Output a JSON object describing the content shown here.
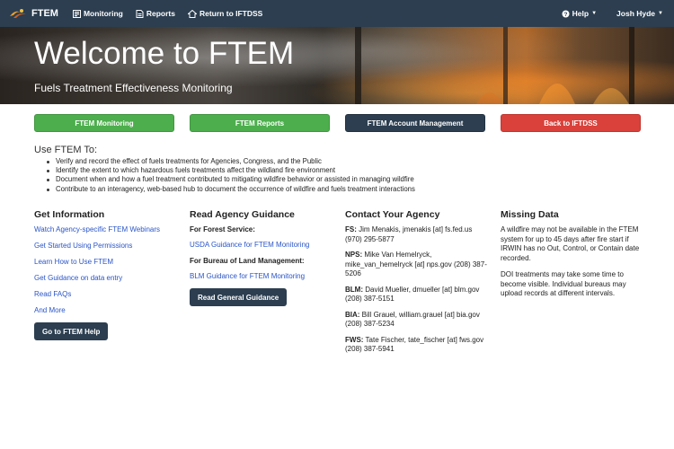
{
  "navbar": {
    "brand": "FTEM",
    "monitoring": "Monitoring",
    "reports": "Reports",
    "return": "Return to IFTDSS",
    "help": "Help",
    "user": "Josh Hyde"
  },
  "hero": {
    "title": "Welcome to FTEM",
    "subtitle": "Fuels Treatment Effectiveness Monitoring"
  },
  "buttons": {
    "monitoring": "FTEM Monitoring",
    "reports": "FTEM Reports",
    "account": "FTEM Account Management",
    "back": "Back to IFTDSS"
  },
  "use": {
    "title": "Use FTEM To:",
    "items": [
      "Verify and record the effect of fuels treatments for Agencies, Congress, and the Public",
      "Identify the extent to which hazardous fuels treatments affect the wildland fire environment",
      "Document when and how a fuel treatment contributed to mitigating wildfire behavior or assisted in managing wildfire",
      "Contribute to an interagency, web-based hub to document the occurrence of wildfire and fuels treatment interactions"
    ]
  },
  "info": {
    "title": "Get Information",
    "links": [
      "Watch Agency-specific FTEM Webinars",
      "Get Started Using Permissions",
      "Learn How to Use FTEM",
      "Get Guidance on data entry",
      "Read FAQs",
      "And More"
    ],
    "button": "Go to FTEM Help"
  },
  "guidance": {
    "title": "Read Agency Guidance",
    "fs_label": "For Forest Service:",
    "fs_link": "USDA Guidance for FTEM Monitoring",
    "blm_label": "For Bureau of Land Management:",
    "blm_link": "BLM Guidance for FTEM Monitoring",
    "button": "Read General Guidance"
  },
  "contact": {
    "title": "Contact Your Agency",
    "entries": [
      {
        "agency": "FS:",
        "text": " Jim Menakis, jmenakis [at] fs.fed.us (970) 295-5877"
      },
      {
        "agency": "NPS:",
        "text": " Mike Van Hemelryck, mike_van_hemelryck [at] nps.gov (208) 387-5206"
      },
      {
        "agency": "BLM:",
        "text": " David Mueller, dmueller [at] blm.gov (208) 387-5151"
      },
      {
        "agency": "BIA:",
        "text": " Bill Grauel, william.grauel [at] bia.gov (208) 387-5234"
      },
      {
        "agency": "FWS:",
        "text": " Tate Fischer, tate_fischer [at] fws.gov (208) 387-5941"
      }
    ]
  },
  "missing": {
    "title": "Missing Data",
    "p1": "A wildfire may not be available in the FTEM system for up to 45 days after fire start if IRWIN has no Out, Control, or Contain date recorded.",
    "p2": "DOI treatments may take some time to become visible. Individual bureaus may upload records at different intervals."
  },
  "colors": {
    "navbar": "#2c3e50",
    "green": "#4cae4c",
    "red": "#d9413a",
    "link": "#2a55c8"
  }
}
